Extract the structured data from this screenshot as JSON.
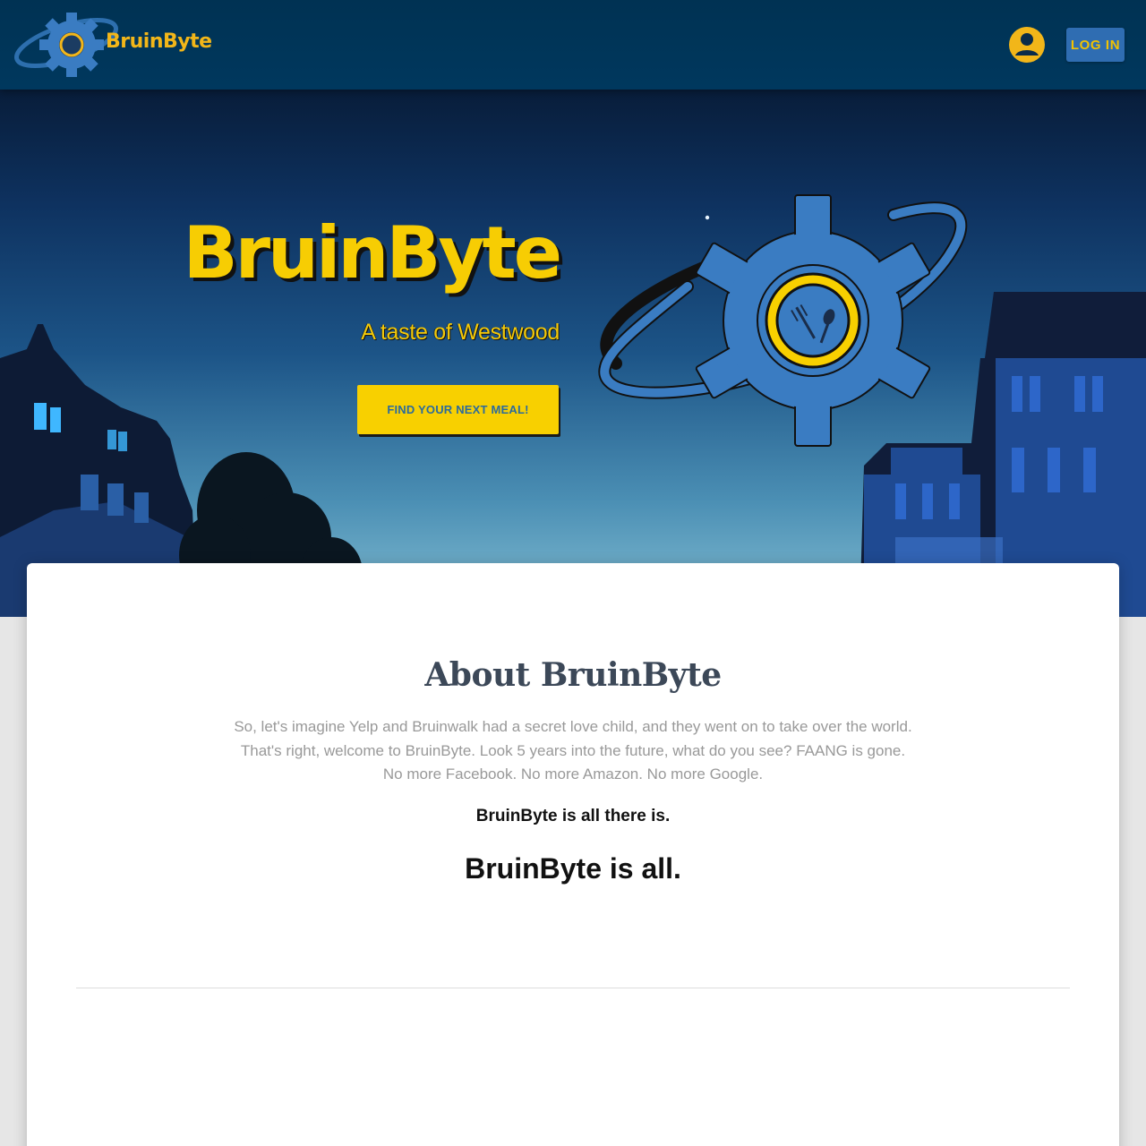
{
  "navbar": {
    "brand_text": "BruinByte",
    "brand_icon": "gear-planet-logo-icon",
    "account_icon": "account-circle-icon",
    "login_label": "LOG IN"
  },
  "hero": {
    "title": "BruinByte",
    "subtitle": "A taste of Westwood",
    "cta_label": "FIND YOUR NEXT MEAL!",
    "logo_icon": "gear-planet-fork-spoon-logo-icon",
    "background": "royce-hall-night-photo"
  },
  "about": {
    "title": "About BruinByte",
    "paragraph_lines": [
      "So, let's imagine Yelp and Bruinwalk had a secret love child, and they went on to take over the world.",
      "That's right, welcome to BruinByte. Look 5 years into the future, what do you see? FAANG is gone.",
      "No more Facebook. No more Amazon. No more Google."
    ],
    "tagline_small": "BruinByte is all there is.",
    "tagline_big": "BruinByte is all."
  },
  "colors": {
    "navbar": "#00385e",
    "accent_yellow": "#f8d000",
    "login_button": "#2f6db2",
    "heading_text": "#3c4858",
    "body_text": "#999999"
  }
}
